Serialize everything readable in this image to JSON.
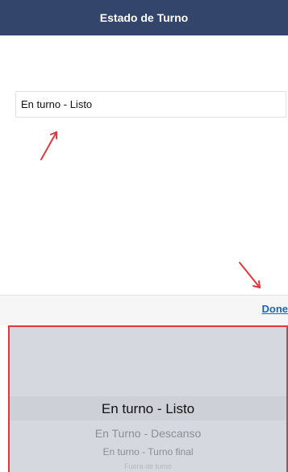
{
  "header": {
    "title": "Estado de Turno"
  },
  "status_field": {
    "value": "En turno - Listo"
  },
  "toolbar": {
    "done_label": "Done"
  },
  "picker": {
    "options": [
      "En turno - Listo",
      "En Turno - Descanso",
      "En turno - Turno final",
      "Fuera de turno"
    ],
    "selected": "En turno - Listo"
  },
  "colors": {
    "nav_bar": "#34456b",
    "done_link": "#1a64c8",
    "annotation_red": "#e0383d"
  }
}
